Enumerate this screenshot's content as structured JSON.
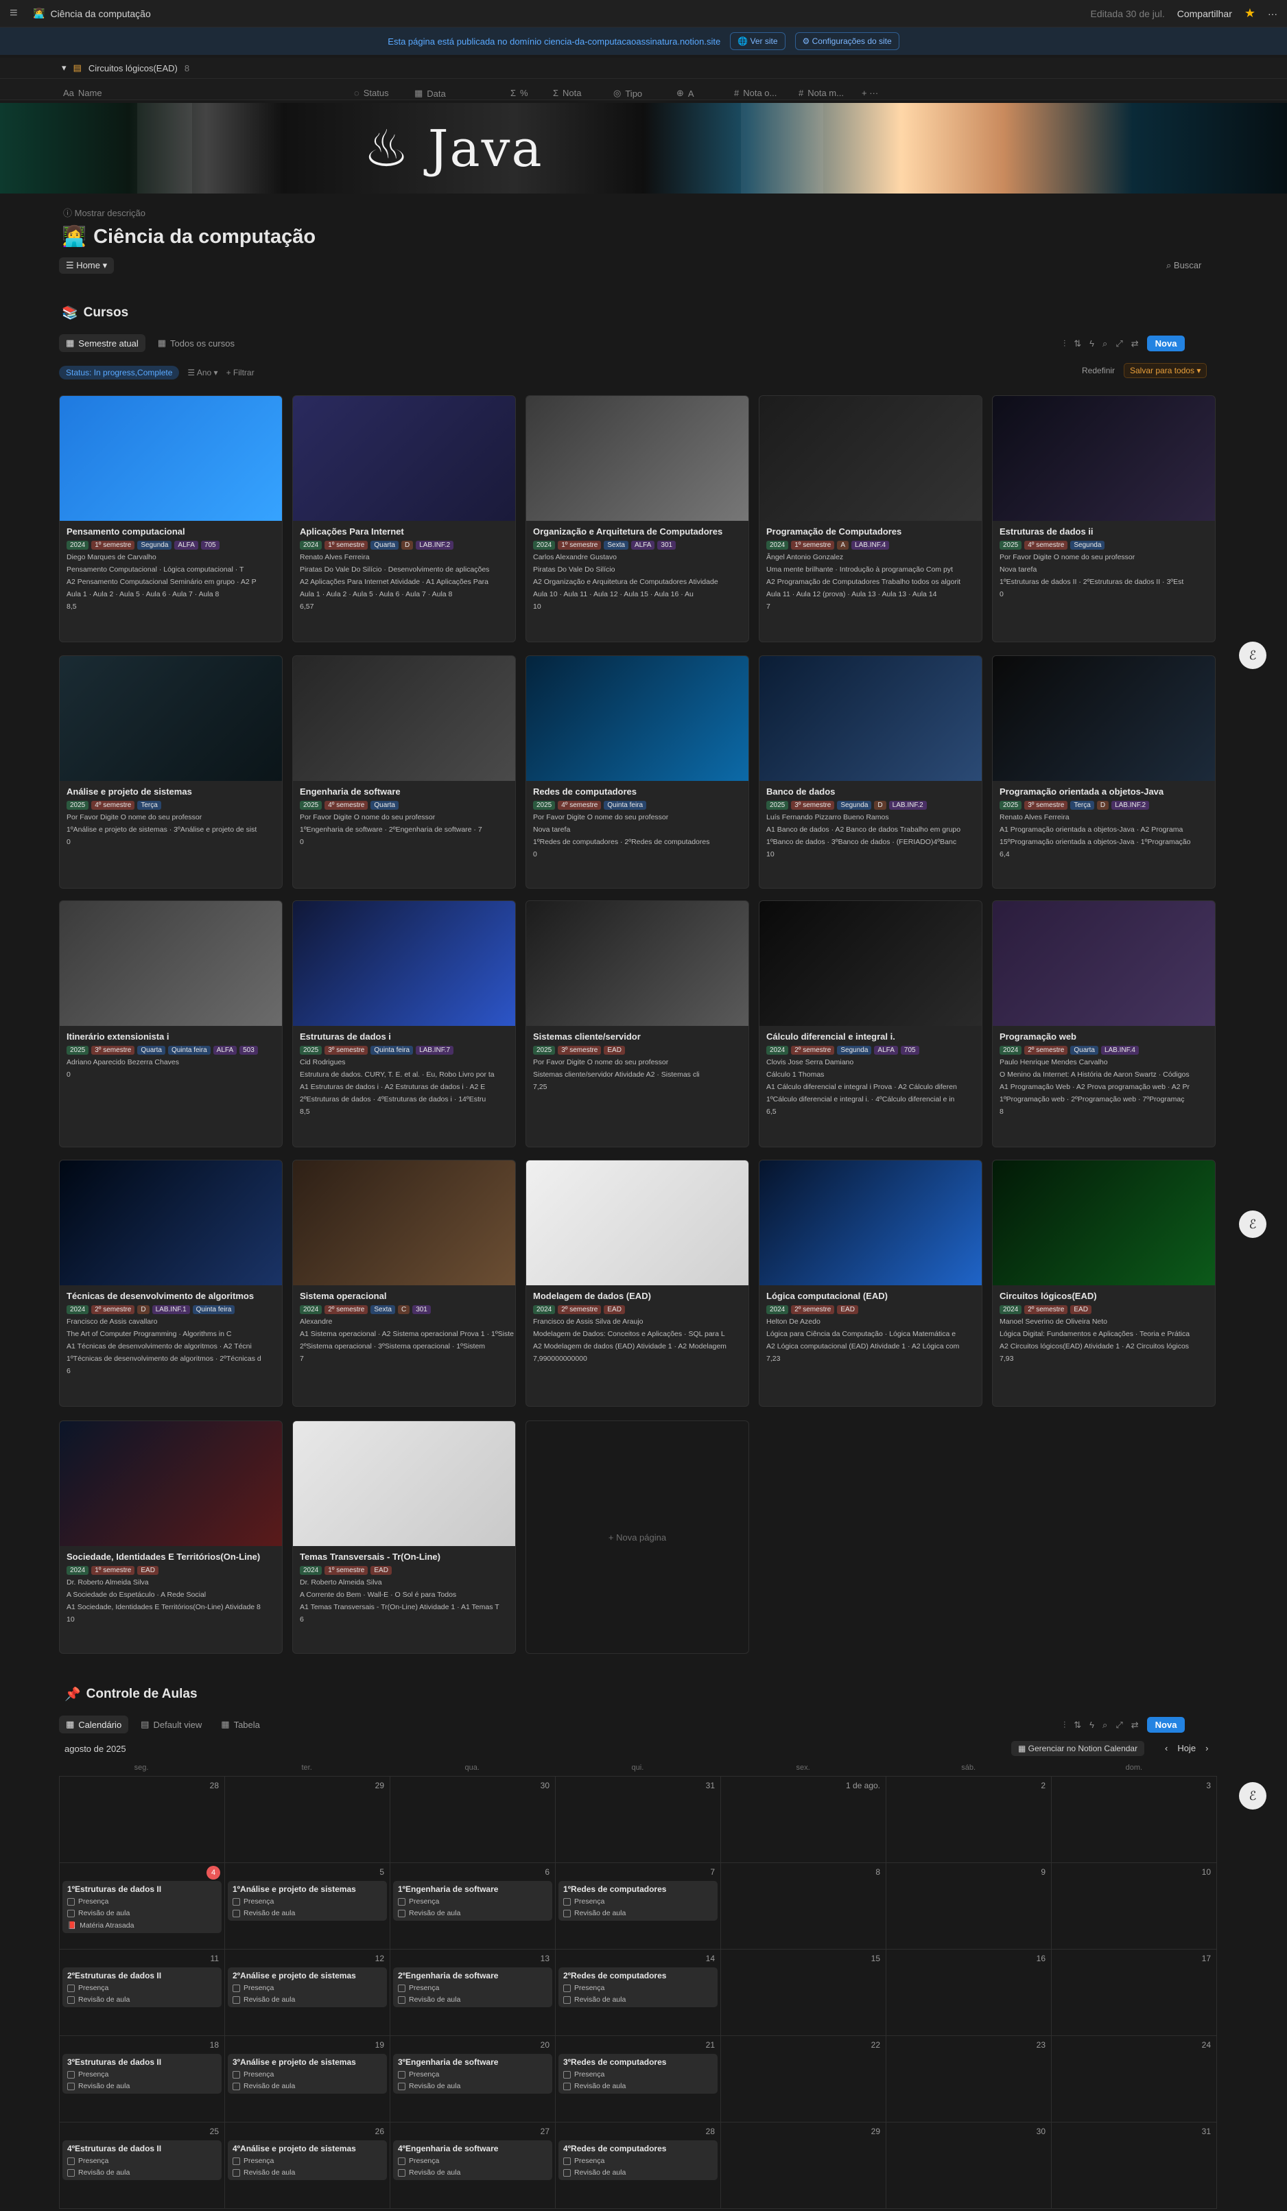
{
  "topbar": {
    "title": "Ciência da computação",
    "edited": "Editada 30 de jul.",
    "share": "Compartilhar"
  },
  "publish": {
    "text": "Esta página está publicada no domínio ciencia-da-computacaoassinatura.notion.site",
    "view_site": "Ver site",
    "site_settings": "Configurações do site"
  },
  "dbstrip": {
    "name": "Circuitos lógicos(EAD)",
    "count": "8",
    "columns": [
      "Name",
      "Status",
      "Data",
      "%",
      "Nota",
      "Tipo",
      "A",
      "Nota o...",
      "Nota m..."
    ]
  },
  "page": {
    "show_description": "Mostrar descrição",
    "title": "Ciência da computação",
    "home": "Home",
    "search": "Buscar"
  },
  "cursos": {
    "title": "Cursos",
    "tabs": [
      "Semestre atual",
      "Todos os cursos"
    ],
    "new": "Nova",
    "filters": [
      "Status: In progress,Complete",
      "Ano",
      "Filtrar"
    ],
    "reset": "Redefinir",
    "save_all": "Salvar para todos",
    "new_page": "+ Nova página",
    "cards": [
      {
        "title": "Pensamento computacional",
        "tags": [
          "2024",
          "1º semestre",
          "Segunda",
          "ALFA",
          "705"
        ],
        "lines": [
          "Diego Marques de Carvalho",
          "Pensamento Computacional · Lógica computacional · T",
          "A2 Pensamento Computacional Seminário em grupo · A2 P",
          "Aula 1 · Aula 2 · Aula 5 · Aula 6 · Aula 7 · Aula 8"
        ],
        "num": "8,5"
      },
      {
        "title": "Aplicações Para Internet",
        "tags": [
          "2024",
          "1º semestre",
          "Quarta",
          "D",
          "LAB.INF.2"
        ],
        "lines": [
          "Renato Alves Ferreira",
          "Piratas Do Vale Do Silício · Desenvolvimento de aplicações",
          "A2 Aplicações Para Internet Atividade · A1 Aplicações Para",
          "Aula 1 · Aula 2 · Aula 5 · Aula 6 · Aula 7 · Aula 8"
        ],
        "num": "6,57"
      },
      {
        "title": "Organização e Arquitetura de Computadores",
        "tags": [
          "2024",
          "1º semestre",
          "Sexta",
          "ALFA",
          "301"
        ],
        "lines": [
          "Carlos Alexandre Gustavo",
          "Piratas Do Vale Do Silício",
          "A2 Organização e Arquitetura de Computadores Atividade",
          "Aula 10 · Aula 11 · Aula 12 · Aula 15 · Aula 16 · Au"
        ],
        "num": "10"
      },
      {
        "title": "Programação de Computadores",
        "tags": [
          "2024",
          "1º semestre",
          "A",
          "LAB.INF.4"
        ],
        "lines": [
          "Ângel Antonio Gonzalez",
          "Uma mente brilhante · Introdução à programação Com pyt",
          "A2 Programação de Computadores Trabalho todos os algorit",
          "Aula 11 · Aula 12 (prova) · Aula 13 · Aula 13 · Aula 14"
        ],
        "num": "7"
      },
      {
        "title": "Estruturas de dados ii",
        "tags": [
          "2025",
          "4º semestre",
          "Segunda"
        ],
        "lines": [
          "Por Favor Digite O nome do seu professor",
          "Nova tarefa",
          "1ºEstruturas de dados II · 2ºEstruturas de dados II · 3ºEst"
        ],
        "num": "0"
      },
      {
        "title": "Análise e projeto de sistemas",
        "tags": [
          "2025",
          "4º semestre",
          "Terça"
        ],
        "lines": [
          "Por Favor Digite O nome do seu professor",
          "1ºAnálise e projeto de sistemas · 3ºAnálise e projeto de sist"
        ],
        "num": "0"
      },
      {
        "title": "Engenharia de software",
        "tags": [
          "2025",
          "4º semestre",
          "Quarta"
        ],
        "lines": [
          "Por Favor Digite O nome do seu professor",
          "1ºEngenharia de software · 2ºEngenharia de software · 7"
        ],
        "num": "0"
      },
      {
        "title": "Redes de computadores",
        "tags": [
          "2025",
          "4º semestre",
          "Quinta feira"
        ],
        "lines": [
          "Por Favor Digite O nome do seu professor",
          "Nova tarefa",
          "1ºRedes de computadores · 2ºRedes de computadores"
        ],
        "num": "0"
      },
      {
        "title": "Banco de dados",
        "tags": [
          "2025",
          "3º semestre",
          "Segunda",
          "D",
          "LAB.INF.2"
        ],
        "lines": [
          "Luís Fernando Pizzarro Bueno Ramos",
          "A1 Banco de dados · A2 Banco de dados Trabalho em grupo",
          "1ºBanco de dados · 3ºBanco de dados · (FERIADO)4ºBanc"
        ],
        "num": "10"
      },
      {
        "title": "Programação orientada a objetos-Java",
        "tags": [
          "2025",
          "3º semestre",
          "Terça",
          "D",
          "LAB.INF.2"
        ],
        "lines": [
          "Renato Alves Ferreira",
          "A1 Programação orientada a objetos-Java · A2 Programa",
          "15ºProgramação orientada a objetos-Java · 1ºProgramação"
        ],
        "num": "6,4"
      },
      {
        "title": "Itinerário extensionista i",
        "tags": [
          "2025",
          "3º semestre",
          "Quarta",
          "Quinta feira",
          "ALFA",
          "503"
        ],
        "lines": [
          "Adriano Aparecido Bezerra Chaves"
        ],
        "num": "0"
      },
      {
        "title": "Estruturas de dados i",
        "tags": [
          "2025",
          "3º semestre",
          "Quinta feira",
          "LAB.INF.7"
        ],
        "lines": [
          "Cid Rodrigues",
          "Estrutura de dados. CURY, T. E. et al. · Eu, Robo Livro por ta",
          "A1 Estruturas de dados i · A2 Estruturas de dados i · A2 E",
          "2ºEstruturas de dados · 4ºEstruturas de dados i · 14ºEstru"
        ],
        "num": "8,5"
      },
      {
        "title": "Sistemas cliente/servidor",
        "tags": [
          "2025",
          "3º semestre",
          "EAD"
        ],
        "lines": [
          "Por Favor Digite O nome do seu professor",
          "Sistemas cliente/servidor Atividade A2 · Sistemas cli"
        ],
        "num": "7,25"
      },
      {
        "title": "Cálculo diferencial e integral i.",
        "tags": [
          "2024",
          "2º semestre",
          "Segunda",
          "ALFA",
          "705"
        ],
        "lines": [
          "Clovis Jose Serra Damiano",
          "Cálculo 1 Thomas",
          "A1 Cálculo diferencial e integral i Prova · A2 Cálculo diferen",
          "1ºCálculo diferencial e integral i. · 4ºCálculo diferencial e in"
        ],
        "num": "6,5"
      },
      {
        "title": "Programação web",
        "tags": [
          "2024",
          "2º semestre",
          "Quarta",
          "LAB.INF.4"
        ],
        "lines": [
          "Paulo Henrique Mendes Carvalho",
          "O Menino da Internet: A História de Aaron Swartz · Códigos",
          "A1 Programação Web · A2 Prova programação web · A2 Pr",
          "1ºProgramação web · 2ºProgramação web · 7ºProgramaç"
        ],
        "num": "8"
      },
      {
        "title": "Técnicas de desenvolvimento de algoritmos",
        "tags": [
          "2024",
          "2º semestre",
          "D",
          "LAB.INF.1",
          "Quinta feira"
        ],
        "lines": [
          "Francisco de Assis cavallaro",
          "The Art of Computer Programming · Algorithms in C",
          "A1 Técnicas de desenvolvimento de algoritmos · A2 Técni",
          "1ºTécnicas de desenvolvimento de algoritmos · 2ºTécnicas d"
        ],
        "num": "6"
      },
      {
        "title": "Sistema operacional",
        "tags": [
          "2024",
          "2º semestre",
          "Sexta",
          "C",
          "301"
        ],
        "lines": [
          "Alexandre",
          "A1 Sistema operacional · A2 Sistema operacional Prova 1 · 1ºSiste",
          "2ºSistema operacional · 3ºSistema operacional · 1ºSistem"
        ],
        "num": "7"
      },
      {
        "title": "Modelagem de dados (EAD)",
        "tags": [
          "2024",
          "2º semestre",
          "EAD"
        ],
        "lines": [
          "Francisco de Assis Silva de Araujo",
          "Modelagem de Dados: Conceitos e Aplicações · SQL para L",
          "A2 Modelagem de dados (EAD) Atividade 1 · A2 Modelagem"
        ],
        "num": "7,990000000000"
      },
      {
        "title": "Lógica computacional (EAD)",
        "tags": [
          "2024",
          "2º semestre",
          "EAD"
        ],
        "lines": [
          "Helton De Azedo",
          "Lógica para Ciência da Computação · Lógica Matemática e",
          "A2 Lógica computacional (EAD) Atividade 1 · A2 Lógica com"
        ],
        "num": "7,23"
      },
      {
        "title": "Circuitos lógicos(EAD)",
        "tags": [
          "2024",
          "2º semestre",
          "EAD"
        ],
        "lines": [
          "Manoel Severino de Oliveira Neto",
          "Lógica Digital: Fundamentos e Aplicações · Teoria e Prática",
          "A2 Circuitos lógicos(EAD) Atividade 1 · A2 Circuitos lógicos"
        ],
        "num": "7,93"
      },
      {
        "title": "Sociedade, Identidades E Territórios(On-Line)",
        "tags": [
          "2024",
          "1º semestre",
          "EAD"
        ],
        "lines": [
          "Dr. Roberto Almeida Silva",
          "A Sociedade do Espetáculo · A Rede Social",
          "A1 Sociedade, Identidades E Territórios(On-Line) Atividade 8"
        ],
        "num": "10"
      },
      {
        "title": "Temas Transversais - Tr(On-Line)",
        "tags": [
          "2024",
          "1º semestre",
          "EAD"
        ],
        "lines": [
          "Dr. Roberto Almeida Silva",
          "A Corrente do Bem · Wall-E · O Sol é para Todos",
          "A1 Temas Transversais - Tr(On-Line) Atividade 1 · A1 Temas T"
        ],
        "num": "6"
      }
    ]
  },
  "controle": {
    "title": "Controle de Aulas",
    "tabs": [
      "Calendário",
      "Default view",
      "Tabela"
    ],
    "new": "Nova",
    "month": "agosto de 2025",
    "gcal": "Gerenciar no Notion Calendar",
    "today": "Hoje",
    "weekdays": [
      "seg.",
      "ter.",
      "qua.",
      "qui.",
      "sex.",
      "sáb.",
      "dom."
    ],
    "weeks": [
      [
        "28",
        "29",
        "30",
        "31",
        "1 de ago.",
        "2",
        "3"
      ],
      [
        "4",
        "5",
        "6",
        "7",
        "8",
        "9",
        "10"
      ],
      [
        "11",
        "12",
        "13",
        "14",
        "15",
        "16",
        "17"
      ],
      [
        "18",
        "19",
        "20",
        "21",
        "22",
        "23",
        "24"
      ],
      [
        "25",
        "26",
        "27",
        "28",
        "29",
        "30",
        "31"
      ]
    ],
    "events": {
      "w1": [
        "1ºEstruturas de dados II",
        "1ºAnálise e projeto de sistemas",
        "1ºEngenharia de software",
        "1ºRedes de computadores"
      ],
      "w2": [
        "2ºEstruturas de dados II",
        "2ºAnálise e projeto de sistemas",
        "2ºEngenharia de software",
        "2ºRedes de computadores"
      ],
      "w3": [
        "3ºEstruturas de dados II",
        "3ºAnálise e projeto de sistemas",
        "3ºEngenharia de software",
        "3ºRedes de computadores"
      ],
      "w4": [
        "4ºEstruturas de dados II",
        "4ºAnálise e projeto de sistemas",
        "4ºEngenharia de software",
        "4ºRedes de computadores"
      ]
    },
    "presence": "Presença",
    "review": "Revisão de aula",
    "late": "Matéria Atrasada"
  },
  "colors": {
    "accent": "#2383e2",
    "today_badge": "#eb5757"
  }
}
